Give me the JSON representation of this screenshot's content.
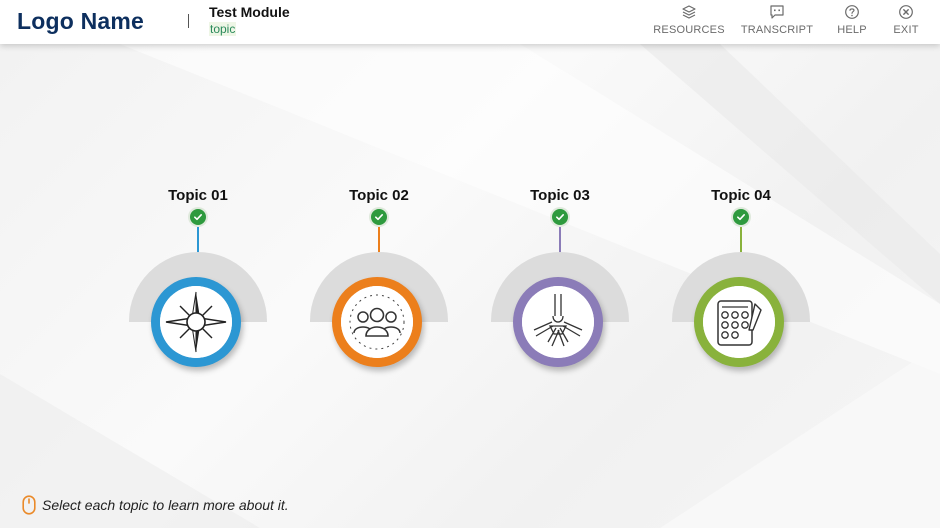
{
  "header": {
    "logo": "Logo Name",
    "module_title": "Test Module",
    "module_subtitle": "topic",
    "nav": [
      {
        "label": "RESOURCES",
        "icon": "layers-icon"
      },
      {
        "label": "TRANSCRIPT",
        "icon": "chat-icon"
      },
      {
        "label": "HELP",
        "icon": "help-icon"
      },
      {
        "label": "EXIT",
        "icon": "close-icon"
      }
    ]
  },
  "topics": [
    {
      "title": "Topic 01",
      "icon": "compass-icon",
      "color": "#2c97d3",
      "completed": true
    },
    {
      "title": "Topic 02",
      "icon": "team-icon",
      "color": "#ec7f1c",
      "completed": true
    },
    {
      "title": "Topic 03",
      "icon": "teamwork-hands-icon",
      "color": "#8b7cb8",
      "completed": true
    },
    {
      "title": "Topic 04",
      "icon": "clipboard-checklist-icon",
      "color": "#89b23c",
      "completed": true
    }
  ],
  "instruction": {
    "icon": "mouse-icon",
    "text": "Select each topic to learn more about it."
  },
  "colors": {
    "logo": "#0d2f5e",
    "check": "#2e9a3e",
    "subtitle": "#2a8a5a"
  }
}
